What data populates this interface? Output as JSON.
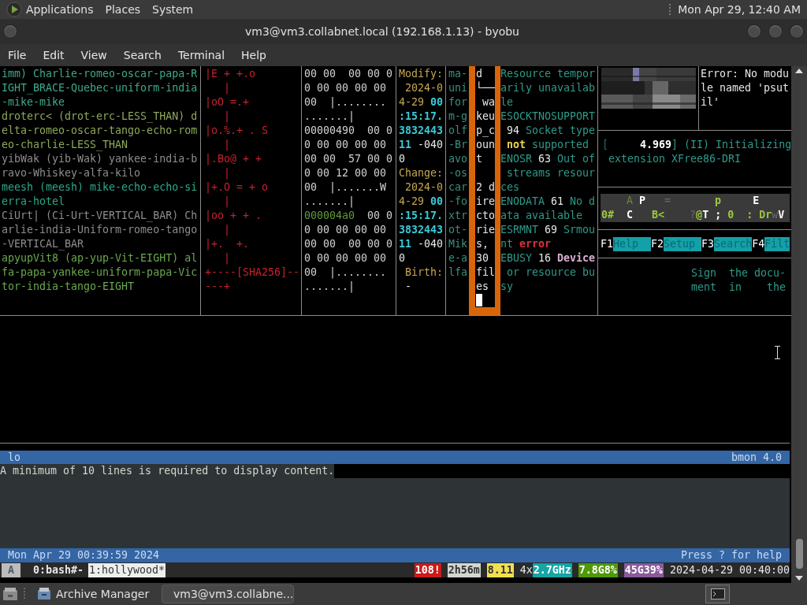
{
  "top_panel": {
    "menus": [
      "Applications",
      "Places",
      "System"
    ],
    "clock": "Mon Apr 29, 12:40 AM"
  },
  "window": {
    "title": "vm3@vm3.collabnet.local (192.168.1.13) - byobu",
    "menu": [
      "File",
      "Edit",
      "View",
      "Search",
      "Terminal",
      "Help"
    ]
  },
  "panes": [
    {
      "kind": "plain",
      "lines": [
        {
          "text": "imm) Charlie-romeo-oscar-papa-R",
          "color": "#3fa88c"
        },
        {
          "text": "IGHT_BRACE-Quebec-uniform-india",
          "color": "#3fa88c"
        },
        {
          "text": "-mike-mike",
          "color": "#3fa88c"
        },
        {
          "text": "droterc< (drot-erc-LESS_THAN) d",
          "color": "#8ea85a"
        },
        {
          "text": "elta-romeo-oscar-tango-echo-rom",
          "color": "#8ea85a"
        },
        {
          "text": "eo-charlie-LESS_THAN",
          "color": "#8ea85a"
        },
        {
          "text": "yibWak (yib-Wak) yankee-india-b",
          "color": "#8c8c8c"
        },
        {
          "text": "ravo-Whiskey-alfa-kilo",
          "color": "#8c8c8c"
        },
        {
          "text": "meesh (meesh) mike-echo-echo-si",
          "color": "#2aa88a"
        },
        {
          "text": "erra-hotel",
          "color": "#2aa88a"
        },
        {
          "text": "CiUrt| (Ci-Urt-VERTICAL_BAR) Ch",
          "color": "#8c8c8c"
        },
        {
          "text": "arlie-india-Uniform-romeo-tango",
          "color": "#8c8c8c"
        },
        {
          "text": "-VERTICAL_BAR",
          "color": "#8c8c8c"
        },
        {
          "text": "apyupVit8 (ap-yup-Vit-EIGHT) al",
          "color": "#6aa84f"
        },
        {
          "text": "fa-papa-yankee-uniform-papa-Vic",
          "color": "#6aa84f"
        },
        {
          "text": "tor-india-tango-EIGHT",
          "color": "#6aa84f"
        }
      ]
    },
    {
      "kind": "plain",
      "lines": [
        "|E + +.o",
        "   |",
        "|oO =.+",
        "   |",
        "|o.%.+ . S",
        "   |",
        "|.Bo@ + +",
        "   |",
        "|+.O = + o",
        "   |",
        "|oo + + .",
        "   |",
        "|+.  +.",
        "   |",
        "+----[SHA256]--",
        "---+"
      ]
    },
    {
      "kind": "plain",
      "lines": [
        "00 00  00 00 0",
        "0 00 00 00 00",
        "00  |........",
        ".......|",
        "00000490  00 0",
        "0 00 00 00 00",
        "00 00  57 00 0",
        "0 00 12 00 00",
        "00  |.......W",
        ".......|",
        {
          "segments": [
            {
              "text": "000004a0",
              "kind": "offset"
            },
            {
              "text": "  00 0"
            }
          ]
        },
        "0 00 00 00 00",
        "00 00  00 00 0",
        "0 00 00 00 00",
        "00  |........",
        ".......|"
      ]
    },
    {
      "kind": "plain",
      "lines": [
        "Modify:",
        " 2024-0",
        {
          "segments": [
            {
              "text": "4-29 "
            },
            {
              "text": "00",
              "kind": "time"
            }
          ]
        },
        {
          "text": ":15:17.",
          "kind": "time"
        },
        {
          "text": "3832443",
          "kind": "time"
        },
        {
          "segments": [
            {
              "text": "11",
              "kind": "time"
            },
            {
              "text": " -040",
              "kind": "value"
            }
          ]
        },
        {
          "text": "0",
          "kind": "value"
        },
        "Change:",
        " 2024-0",
        {
          "segments": [
            {
              "text": "4-29 "
            },
            {
              "text": "00",
              "kind": "time"
            }
          ]
        },
        {
          "text": ":15:17.",
          "kind": "time"
        },
        {
          "text": "3832443",
          "kind": "time"
        },
        {
          "segments": [
            {
              "text": "11",
              "kind": "time"
            },
            {
              "text": " -040",
              "kind": "value"
            }
          ]
        },
        {
          "text": "0",
          "kind": "value"
        },
        " Birth:",
        {
          "text": " -",
          "kind": "value"
        }
      ]
    },
    {
      "kind": "plain",
      "lines": [
        "ma-",
        "uni",
        "for",
        "m-g",
        "olf",
        "-Br",
        "avo",
        "-os",
        "car",
        "-fo",
        "xtr",
        "ot-",
        "Mik",
        "e-a",
        "lfa"
      ]
    },
    {
      "kind": "framed",
      "blocks": [
        [
          "d",
          "└──",
          " wa",
          "keu",
          "p_c",
          "oun",
          "t"
        ],
        [
          "2 d",
          "ire",
          "cto",
          "rie",
          "s,",
          "30",
          "fil",
          "es"
        ]
      ]
    },
    {
      "kind": "plain",
      "lines": [
        "Resource tempor",
        "arily unavailab",
        "le",
        "ESOCKTNOSUPPORT",
        {
          "segments": [
            {
              "text": " 94",
              "kind": "value"
            },
            {
              "text": " Socket type"
            }
          ]
        },
        {
          "segments": [
            {
              "text": " not",
              "kind": "warning"
            },
            {
              "text": " supported"
            }
          ]
        },
        {
          "segments": [
            {
              "text": "ENOSR"
            },
            {
              "text": " 63",
              "kind": "value"
            },
            {
              "text": " Out of"
            }
          ]
        },
        " streams resour",
        "ces",
        {
          "segments": [
            {
              "text": "ENODATA"
            },
            {
              "text": " 61",
              "kind": "value"
            },
            {
              "text": " No d"
            }
          ]
        },
        "ata available",
        {
          "segments": [
            {
              "text": "ESRMNT"
            },
            {
              "text": " 69",
              "kind": "value"
            },
            {
              "text": " Srmou"
            }
          ]
        },
        {
          "segments": [
            {
              "text": "nt"
            },
            {
              "text": " error",
              "kind": "error"
            }
          ]
        },
        {
          "segments": [
            {
              "text": "EBUSY"
            },
            {
              "text": " 16",
              "kind": "value"
            },
            {
              "text": " Device",
              "kind": "device"
            }
          ]
        },
        " or resource bu",
        "sy"
      ]
    }
  ],
  "error_lines": [
    "Error: No modu",
    "le named 'psut",
    "il'"
  ],
  "log_lines": [
    {
      "segments": [
        {
          "text": "[     ",
          "kind": "bracket"
        },
        {
          "text": "4.969",
          "kind": "strong"
        },
        {
          "text": "] (II) Initializing"
        }
      ]
    },
    " extension XFree86-DRI"
  ],
  "key_rows": [
    {
      "segments": [
        {
          "text": "    A",
          "kind": "muted"
        },
        {
          "text": " P",
          "kind": "strong"
        },
        {
          "text": "   =",
          "kind": "faint"
        },
        {
          "text": "       p",
          "kind": "key"
        },
        {
          "text": "     E",
          "kind": "strong"
        }
      ]
    },
    {
      "segments": [
        {
          "text": "0#",
          "kind": "key"
        },
        {
          "text": "  C",
          "kind": "strong"
        },
        {
          "text": "   B<",
          "kind": "key"
        },
        {
          "text": "    ?",
          "kind": "faint"
        },
        {
          "text": "@",
          "kind": "key"
        },
        {
          "text": "T ;",
          "kind": "strong"
        },
        {
          "text": " 0  :",
          "kind": "key"
        },
        {
          "text": " Dr",
          "kind": "key"
        },
        {
          "text": "w",
          "kind": "faint"
        },
        {
          "text": "V",
          "kind": "strong"
        }
      ]
    }
  ],
  "function_keys": [
    {
      "key": "F1",
      "label": "Help"
    },
    {
      "key": "F2",
      "label": "Setup"
    },
    {
      "key": "F3",
      "label": "Search"
    },
    {
      "key": "F4",
      "label": "Filt"
    }
  ],
  "doc_lines": [
    "Sign  the docu-",
    "ment  in    the"
  ],
  "bmon": {
    "header_left": "lo",
    "header_right": "bmon 4.0",
    "message": "A minimum of 10 lines is required to display content.",
    "footer_left": "Mon Apr 29 00:39:59 2024",
    "footer_right": "Press ? for help"
  },
  "byobu": {
    "session": "A",
    "windows": [
      {
        "label": "0:bash#-",
        "selected": false
      },
      {
        "label": "1:hollywood*",
        "selected": true
      }
    ],
    "indicators": [
      {
        "text": "108!",
        "color": "#cc1a1a"
      },
      {
        "text": "2h56m",
        "color": "#d3d7cf"
      },
      {
        "text": "8.11",
        "color": "#f0e050"
      },
      {
        "prefix": "4x",
        "text": "2.7GHz",
        "color": "#14a5a5"
      },
      {
        "text": "7.8G8%",
        "color": "#4e9a06"
      },
      {
        "text": "45G39%",
        "color": "#8a5a9a"
      }
    ],
    "datetime": "2024-04-29 00:40:00"
  },
  "taskbar": {
    "tasks": [
      {
        "label": "Archive Manager",
        "kind": "archive",
        "selected": false
      },
      {
        "label": "vm3@vm3.collabne...",
        "kind": "terminal",
        "selected": true
      }
    ]
  }
}
